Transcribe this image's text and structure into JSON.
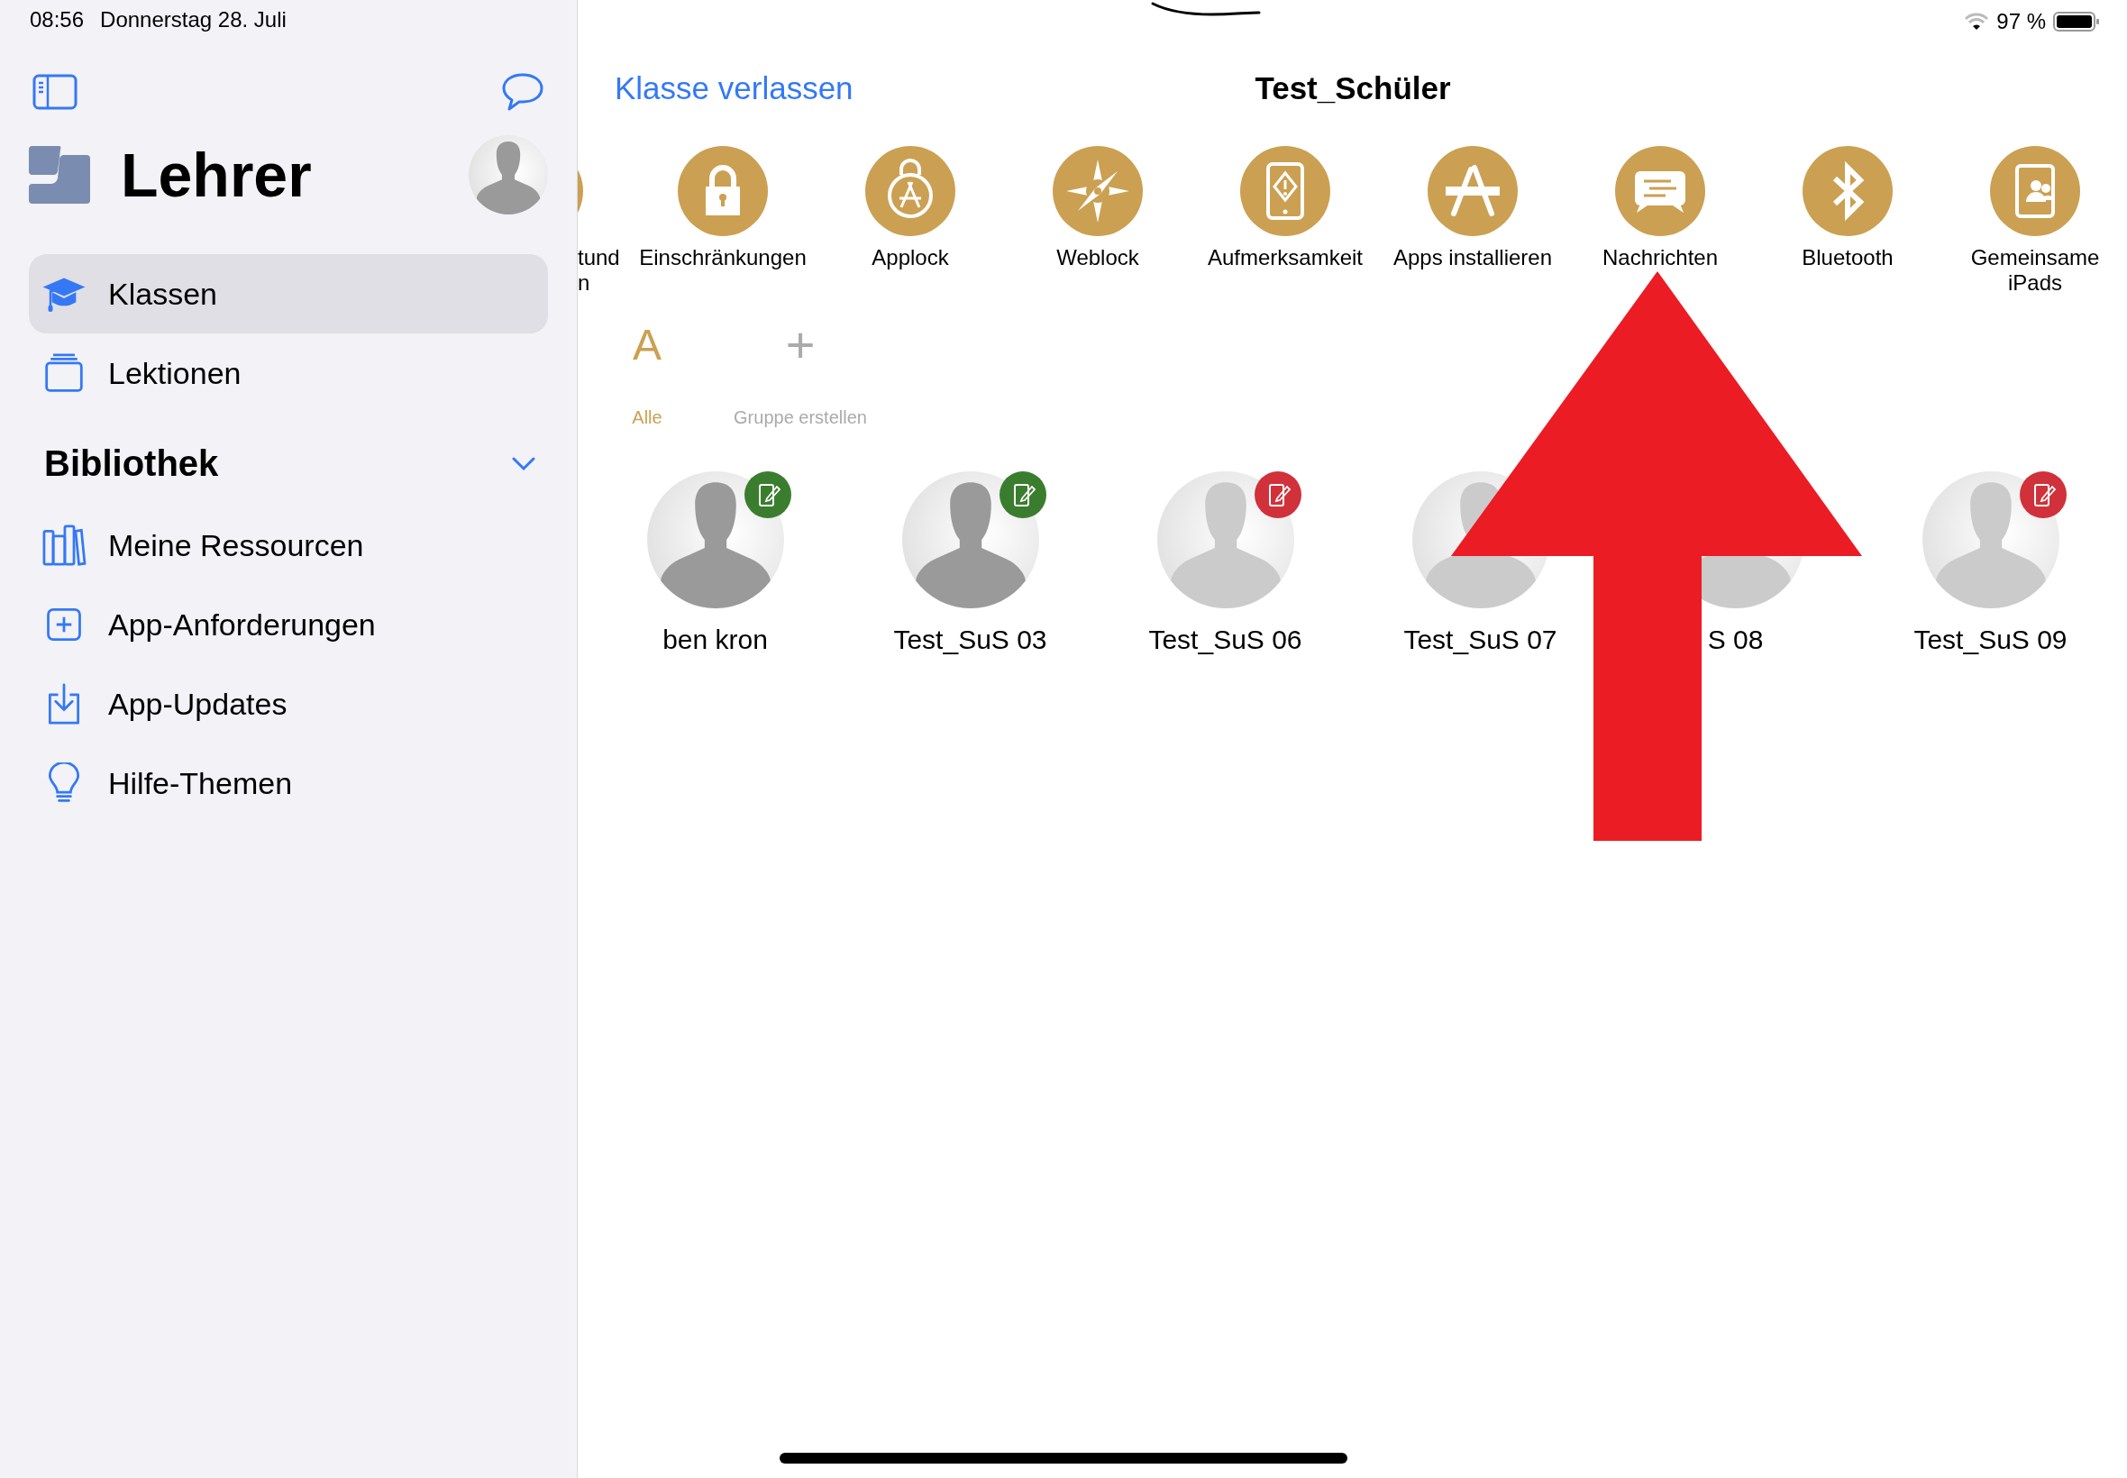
{
  "status_bar": {
    "time": "08:56",
    "date": "Donnerstag 28. Juli",
    "battery_text": "97 %"
  },
  "sidebar": {
    "title": "Lehrer",
    "items": [
      {
        "label": "Klassen",
        "kind": "cap",
        "selected": true
      },
      {
        "label": "Lektionen",
        "kind": "stack",
        "selected": false
      }
    ],
    "section": {
      "title": "Bibliothek",
      "expanded": true,
      "items": [
        {
          "label": "Meine Ressourcen",
          "kind": "books",
          "selected": false
        },
        {
          "label": "App-Anforderungen",
          "kind": "plus",
          "selected": false
        },
        {
          "label": "App-Updates",
          "kind": "download",
          "selected": false
        },
        {
          "label": "Hilfe-Themen",
          "kind": "bulb",
          "selected": false
        }
      ]
    }
  },
  "main": {
    "back_link": "Klasse verlassen",
    "title": "Test_Schüler",
    "actions": [
      {
        "kind": "partial",
        "lines": [
          "tund",
          "n"
        ]
      },
      {
        "kind": "lock",
        "lines": [
          "Einschränkungen"
        ]
      },
      {
        "kind": "applock",
        "lines": [
          "Applock"
        ]
      },
      {
        "kind": "compass",
        "lines": [
          "Weblock"
        ]
      },
      {
        "kind": "attention",
        "lines": [
          "Aufmerksamkeit"
        ]
      },
      {
        "kind": "appstore",
        "lines": [
          "Apps installieren"
        ]
      },
      {
        "kind": "message",
        "lines": [
          "Nachrichten"
        ]
      },
      {
        "kind": "bluetooth",
        "lines": [
          "Bluetooth"
        ]
      },
      {
        "kind": "shared",
        "lines": [
          "Gemeinsame",
          "iPads"
        ]
      }
    ],
    "groups": [
      {
        "kind": "letter",
        "glyph": "A",
        "label": "Alle",
        "selected": true
      },
      {
        "kind": "add",
        "glyph": "+",
        "label": "Gruppe erstellen",
        "selected": false
      }
    ],
    "students": [
      {
        "name": "ben kron",
        "dimmed": false,
        "color": "#3b7d2e"
      },
      {
        "name": "Test_SuS 03",
        "dimmed": false,
        "color": "#3b7d2e"
      },
      {
        "name": "Test_SuS 06",
        "dimmed": true,
        "color": "#d1313a"
      },
      {
        "name": "Test_SuS 07",
        "dimmed": true
      },
      {
        "name": "S 08",
        "dimmed": true
      },
      {
        "name": "Test_SuS 09",
        "dimmed": true,
        "color": "#d1313a"
      }
    ]
  }
}
